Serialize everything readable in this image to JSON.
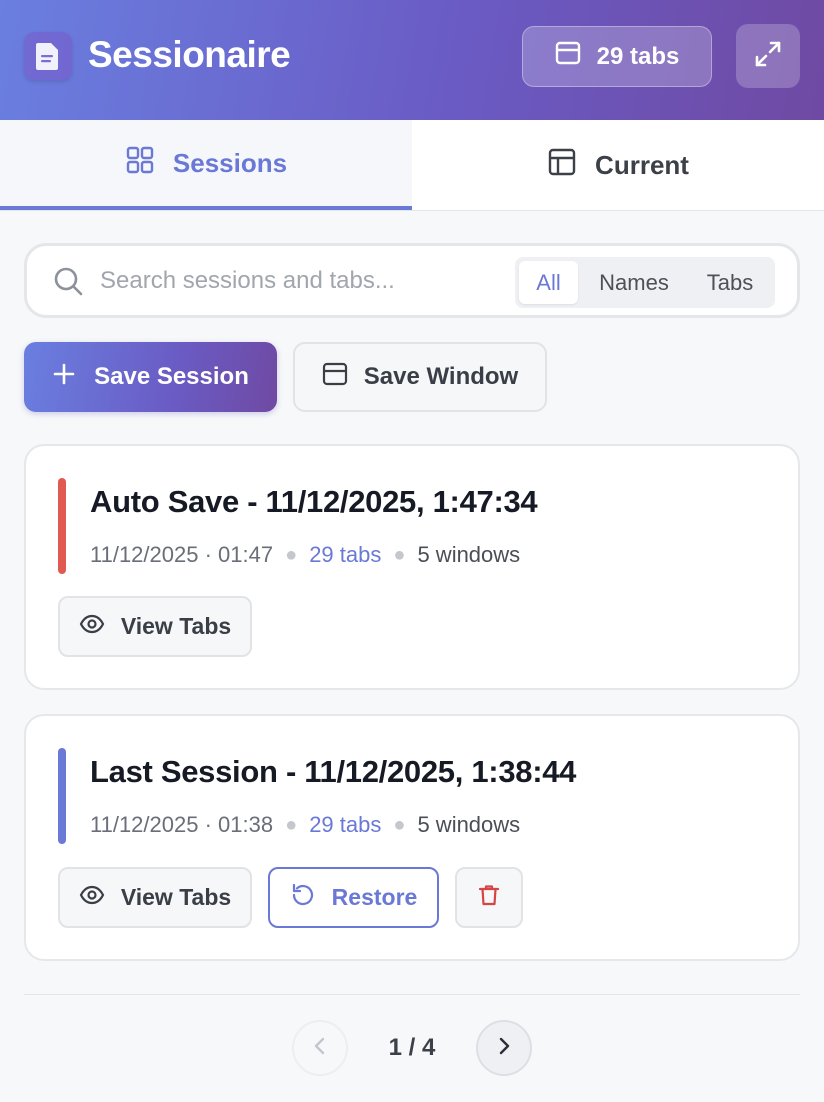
{
  "app": {
    "title": "Sessionaire",
    "tab_count_label": "29 tabs",
    "accent_color": "#6a78d6"
  },
  "nav": {
    "tabs": [
      {
        "label": "Sessions",
        "icon": "grid-icon",
        "active": true
      },
      {
        "label": "Current",
        "icon": "layout-icon",
        "active": false
      }
    ]
  },
  "search": {
    "placeholder": "Search sessions and tabs...",
    "value": "",
    "filters": [
      "All",
      "Names",
      "Tabs"
    ],
    "selected_filter": "All"
  },
  "actions": {
    "save_session_label": "Save Session",
    "save_window_label": "Save Window"
  },
  "sessions": [
    {
      "title": "Auto Save - 11/12/2025, 1:47:34",
      "date": "11/12/2025 · 01:47",
      "tabs": "29 tabs",
      "windows": "5 windows",
      "accent": "#e05a52",
      "buttons": {
        "view": "View Tabs"
      }
    },
    {
      "title": "Last Session - 11/12/2025, 1:38:44",
      "date": "11/12/2025 · 01:38",
      "tabs": "29 tabs",
      "windows": "5 windows",
      "accent": "#6a78d6",
      "buttons": {
        "view": "View Tabs",
        "restore": "Restore"
      }
    }
  ],
  "pagination": {
    "indicator": "1 / 4"
  }
}
